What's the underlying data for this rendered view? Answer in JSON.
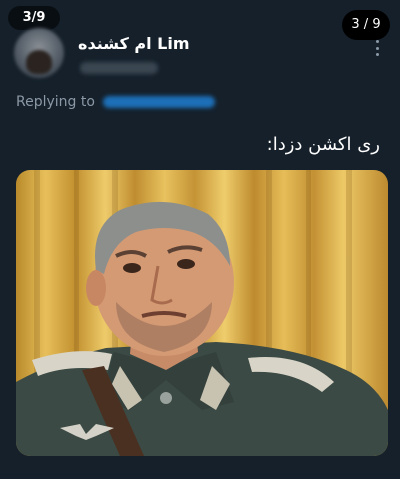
{
  "viewer": {
    "left_counter": "3/9",
    "right_counter": "3 / 9"
  },
  "tweet": {
    "author_name": "ام کشنده Lim",
    "replying_prefix": "Replying to",
    "text": "ری اکشن دزدا:"
  },
  "colors": {
    "background": "#15202b",
    "link": "#1d9bf0",
    "muted": "#8b98a5"
  },
  "icons": {
    "more": "more-vertical-icon"
  },
  "media": {
    "description_visible": false
  }
}
